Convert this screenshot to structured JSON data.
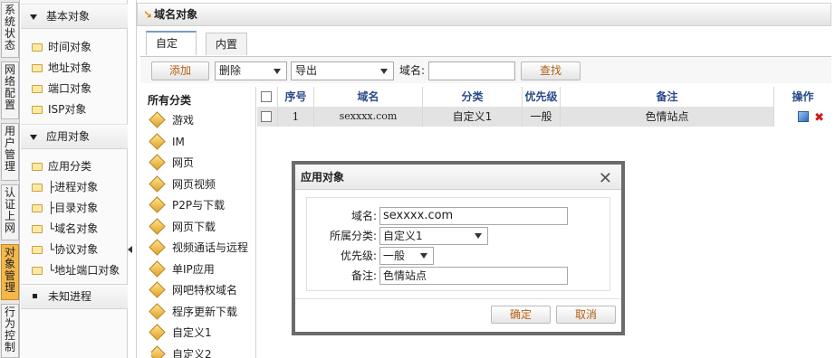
{
  "vertical_tabs": [
    {
      "label": "系统状态",
      "active": false
    },
    {
      "label": "网络配置",
      "active": false
    },
    {
      "label": "用户管理",
      "active": false
    },
    {
      "label": "认证上网",
      "active": false
    },
    {
      "label": "对象管理",
      "active": true
    },
    {
      "label": "行为控制",
      "active": false
    }
  ],
  "tree": {
    "group_basic": "基本对象",
    "basic_items": [
      "时间对象",
      "地址对象",
      "端口对象",
      "ISP对象"
    ],
    "group_app": "应用对象",
    "app_items": [
      "应用分类",
      "├进程对象",
      "├目录对象",
      "└域名对象",
      "└协议对象",
      "└地址端口对象"
    ],
    "unknown_process": "未知进程"
  },
  "main": {
    "title": "域名对象",
    "tabs": [
      "自定义",
      "内置"
    ],
    "toolbar": {
      "add": "添加",
      "delete": "删除",
      "export": "导出",
      "domain_label": "域名:",
      "domain_value": "",
      "search": "查找"
    },
    "categories": {
      "heading": "所有分类",
      "items": [
        "游戏",
        "IM",
        "网页",
        "网页视频",
        "P2P与下载",
        "网页下载",
        "视频通话与远程",
        "单IP应用",
        "网吧特权域名",
        "程序更新下载",
        "自定义1",
        "自定义2"
      ]
    },
    "table": {
      "headers": {
        "seq": "序号",
        "domain": "域名",
        "category": "分类",
        "priority": "优先级",
        "note": "备注",
        "ops": "操作"
      },
      "rows": [
        {
          "seq": "1",
          "domain": "sexxxx.com",
          "category": "自定义1",
          "priority": "一般",
          "note": "色情站点"
        }
      ]
    }
  },
  "modal": {
    "title": "应用对象",
    "domain_label": "域名:",
    "domain_value": "sexxxx.com",
    "category_label": "所属分类:",
    "category_value": "自定义1",
    "priority_label": "优先级:",
    "priority_value": "一般",
    "note_label": "备注:",
    "note_value": "色情站点",
    "ok": "确定",
    "cancel": "取消"
  }
}
